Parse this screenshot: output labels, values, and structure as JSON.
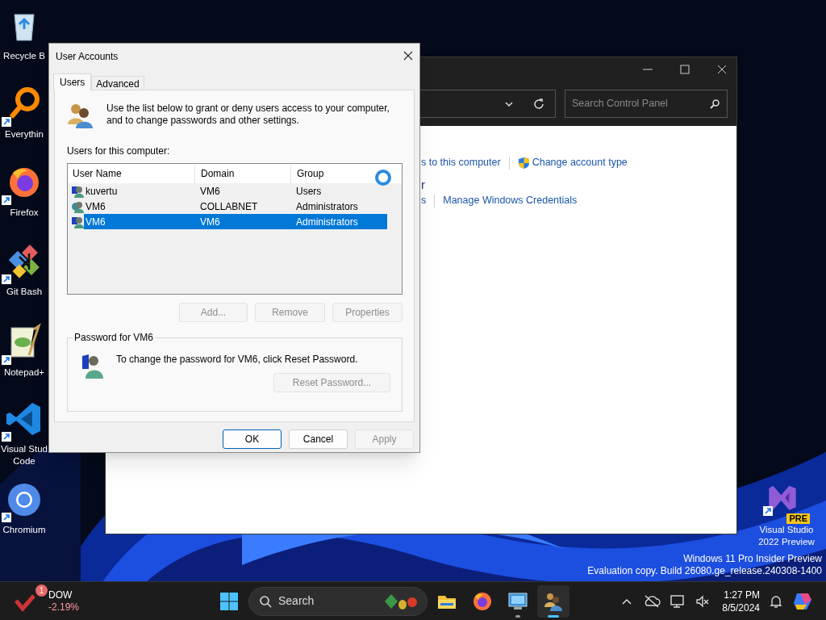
{
  "desktop_icons": [
    {
      "kind": "recycle",
      "lines": [
        "Recycle B"
      ]
    },
    {
      "kind": "everything",
      "lines": [
        "Everythin"
      ]
    },
    {
      "kind": "firefox",
      "lines": [
        "Firefox"
      ]
    },
    {
      "kind": "git",
      "lines": [
        "Git Bash"
      ]
    },
    {
      "kind": "notepad",
      "lines": [
        "Notepad+"
      ]
    },
    {
      "kind": "vscode",
      "lines": [
        "Visual Stud",
        "Code"
      ]
    },
    {
      "kind": "chromium",
      "lines": [
        "Chromium"
      ]
    },
    {
      "kind": "vs",
      "lines": [
        "Visual Studio",
        "2022 Preview"
      ],
      "badge": "PRE"
    }
  ],
  "control_panel": {
    "search_placeholder": "Search Control Panel",
    "link_rows": [
      {
        "items": [
          {
            "kind": "link",
            "text": "s to this computer"
          },
          {
            "kind": "shield-link",
            "text": "Change account type"
          }
        ]
      },
      {
        "items": [
          {
            "kind": "heading",
            "text": "r"
          }
        ]
      },
      {
        "items": [
          {
            "kind": "link",
            "text": "s"
          },
          {
            "kind": "link",
            "text": "Manage Windows Credentials"
          }
        ]
      }
    ]
  },
  "dialog": {
    "title": "User Accounts",
    "tabs": [
      {
        "label": "Users",
        "selected": true
      },
      {
        "label": "Advanced",
        "selected": false
      }
    ],
    "intro": "Use the list below to grant or deny users access to your computer, and to change passwords and other settings.",
    "list_label": "Users for this computer:",
    "columns": [
      "User Name",
      "Domain",
      "Group"
    ],
    "rows": [
      {
        "kind": "local",
        "cells": [
          "kuvertu",
          "VM6",
          "Users"
        ],
        "selected": false
      },
      {
        "kind": "domain",
        "cells": [
          "VM6",
          "COLLABNET",
          "Administrators"
        ],
        "selected": false
      },
      {
        "kind": "local",
        "cells": [
          "VM6",
          "VM6",
          "Administrators"
        ],
        "selected": true
      }
    ],
    "list_buttons": [
      {
        "label": "Add...",
        "disabled": true
      },
      {
        "label": "Remove",
        "disabled": true
      },
      {
        "label": "Properties",
        "disabled": true
      }
    ],
    "password_group": {
      "title": "Password for VM6",
      "text": "To change the password for VM6, click Reset Password.",
      "button": {
        "label": "Reset Password...",
        "disabled": true
      }
    },
    "buttons": [
      {
        "label": "OK",
        "default": true,
        "disabled": false
      },
      {
        "label": "Cancel",
        "default": false,
        "disabled": false
      },
      {
        "label": "Apply",
        "default": false,
        "disabled": true
      }
    ]
  },
  "watermark_lines": [
    "Windows 11 Pro Insider Preview",
    "Evaluation copy. Build 26080.ge_release.240308-1400"
  ],
  "taskbar": {
    "widget": {
      "badge": "1",
      "label": "DOW",
      "change": "-2.19%"
    },
    "search_label": "Search",
    "apps": [
      {
        "kind": "explorer",
        "running": false,
        "active": false
      },
      {
        "kind": "firefox",
        "running": false,
        "active": false
      },
      {
        "kind": "control-panel",
        "running": true,
        "active": false
      },
      {
        "kind": "users",
        "running": true,
        "active": true
      }
    ],
    "time": "1:27 PM",
    "date": "8/5/2024"
  }
}
